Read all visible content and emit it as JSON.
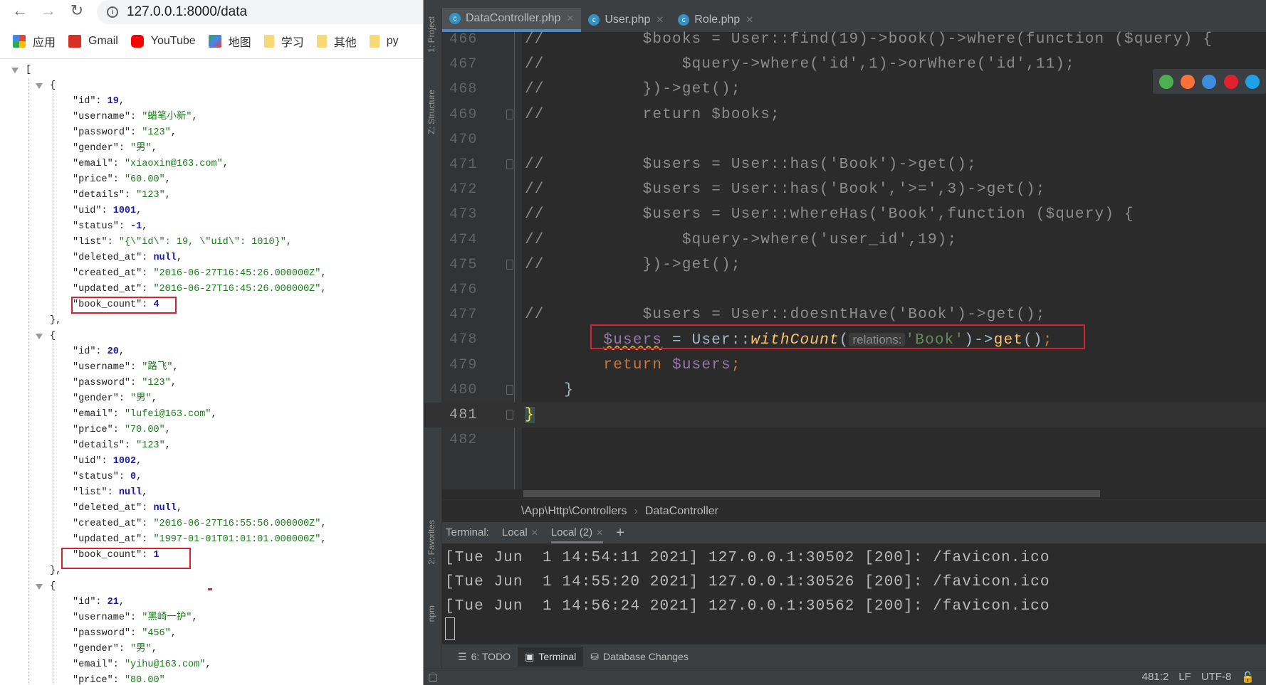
{
  "browser": {
    "url": "127.0.0.1:8000/data",
    "bookmarks": [
      {
        "label": "应用",
        "icon": "apps-grid-icon"
      },
      {
        "label": "Gmail",
        "icon": "gmail-icon"
      },
      {
        "label": "YouTube",
        "icon": "youtube-icon"
      },
      {
        "label": "地图",
        "icon": "maps-icon"
      },
      {
        "label": "学习",
        "icon": "folder-icon"
      },
      {
        "label": "其他",
        "icon": "folder-icon"
      },
      {
        "label": "py",
        "icon": "folder-icon"
      }
    ],
    "json_open": "[",
    "records": [
      {
        "fields": [
          {
            "key": "id",
            "value": "19",
            "type": "n"
          },
          {
            "key": "username",
            "value": "蜡笔小新",
            "type": "s"
          },
          {
            "key": "password",
            "value": "123",
            "type": "s"
          },
          {
            "key": "gender",
            "value": "男",
            "type": "s"
          },
          {
            "key": "email",
            "value": "xiaoxin@163.com",
            "type": "s"
          },
          {
            "key": "price",
            "value": "60.00",
            "type": "s"
          },
          {
            "key": "details",
            "value": "123",
            "type": "s"
          },
          {
            "key": "uid",
            "value": "1001",
            "type": "n"
          },
          {
            "key": "status",
            "value": "-1",
            "type": "n"
          },
          {
            "key": "list",
            "value": "{\\\"id\\\": 19, \\\"uid\\\": 1010}",
            "type": "s"
          },
          {
            "key": "deleted_at",
            "value": "null",
            "type": "n"
          },
          {
            "key": "created_at",
            "value": "2016-06-27T16:45:26.000000Z",
            "type": "s"
          },
          {
            "key": "updated_at",
            "value": "2016-06-27T16:45:26.000000Z",
            "type": "s"
          },
          {
            "key": "book_count",
            "value": "4",
            "type": "n",
            "highlight": true
          }
        ]
      },
      {
        "fields": [
          {
            "key": "id",
            "value": "20",
            "type": "n"
          },
          {
            "key": "username",
            "value": "路飞",
            "type": "s"
          },
          {
            "key": "password",
            "value": "123",
            "type": "s"
          },
          {
            "key": "gender",
            "value": "男",
            "type": "s"
          },
          {
            "key": "email",
            "value": "lufei@163.com",
            "type": "s"
          },
          {
            "key": "price",
            "value": "70.00",
            "type": "s"
          },
          {
            "key": "details",
            "value": "123",
            "type": "s"
          },
          {
            "key": "uid",
            "value": "1002",
            "type": "n"
          },
          {
            "key": "status",
            "value": "0",
            "type": "n"
          },
          {
            "key": "list",
            "value": "null",
            "type": "n"
          },
          {
            "key": "deleted_at",
            "value": "null",
            "type": "n"
          },
          {
            "key": "created_at",
            "value": "2016-06-27T16:55:56.000000Z",
            "type": "s"
          },
          {
            "key": "updated_at",
            "value": "1997-01-01T01:01:01.000000Z",
            "type": "s"
          },
          {
            "key": "book_count",
            "value": "1",
            "type": "n",
            "highlight": true
          }
        ]
      },
      {
        "fields": [
          {
            "key": "id",
            "value": "21",
            "type": "n"
          },
          {
            "key": "username",
            "value": "黑崎一护",
            "type": "s"
          },
          {
            "key": "password",
            "value": "456",
            "type": "s"
          },
          {
            "key": "gender",
            "value": "男",
            "type": "s"
          },
          {
            "key": "email",
            "value": "yihu@163.com",
            "type": "s"
          },
          {
            "key": "price",
            "value": "80.00",
            "type": "s"
          }
        ]
      }
    ]
  },
  "ide": {
    "side_labels": [
      "1: Project",
      "Z: Structure",
      "2: Favorites",
      "npm"
    ],
    "tabs": [
      {
        "label": "DataController.php",
        "active": true
      },
      {
        "label": "User.php",
        "active": false
      },
      {
        "label": "Role.php",
        "active": false
      }
    ],
    "code_lines": [
      {
        "num": "466",
        "tokens": [
          [
            "t-cm",
            "//          $books = User::find(19)->book()->where(function ($query) {"
          ]
        ]
      },
      {
        "num": "467",
        "tokens": [
          [
            "t-cm",
            "//              $query->where('id',1)->orWhere('id',11);"
          ]
        ]
      },
      {
        "num": "468",
        "tokens": [
          [
            "t-cm",
            "//          })->get();"
          ]
        ]
      },
      {
        "num": "469",
        "fold": true,
        "tokens": [
          [
            "t-cm",
            "//          return $books;"
          ]
        ]
      },
      {
        "num": "470",
        "tokens": []
      },
      {
        "num": "471",
        "fold": true,
        "tokens": [
          [
            "t-cm",
            "//          $users = User::has('Book')->get();"
          ]
        ]
      },
      {
        "num": "472",
        "tokens": [
          [
            "t-cm",
            "//          $users = User::has('Book','>=',3)->get();"
          ]
        ]
      },
      {
        "num": "473",
        "tokens": [
          [
            "t-cm",
            "//          $users = User::whereHas('Book',function ($query) {"
          ]
        ]
      },
      {
        "num": "474",
        "tokens": [
          [
            "t-cm",
            "//              $query->where('user_id',19);"
          ]
        ]
      },
      {
        "num": "475",
        "fold": true,
        "tokens": [
          [
            "t-cm",
            "//          })->get();"
          ]
        ]
      },
      {
        "num": "476",
        "tokens": []
      },
      {
        "num": "477",
        "tokens": [
          [
            "t-cm",
            "//          $users = User::doesntHave('Book')->get();"
          ]
        ]
      },
      {
        "num": "478",
        "tokens": [
          [
            "t-plain",
            "        "
          ],
          [
            "t-var squig",
            "$users"
          ],
          [
            "t-plain",
            " = User::"
          ],
          [
            "t-fn",
            "withCount"
          ],
          [
            "t-plain",
            "("
          ],
          [
            "t-hint",
            "relations:"
          ],
          [
            "t-str",
            "'Book'"
          ],
          [
            "t-plain",
            ")->"
          ],
          [
            "t-call",
            "get"
          ],
          [
            "t-plain",
            "()"
          ],
          [
            "t-kw",
            ";"
          ]
        ]
      },
      {
        "num": "479",
        "tokens": [
          [
            "t-kw",
            "        return "
          ],
          [
            "t-var",
            "$users"
          ],
          [
            "t-kw",
            ";"
          ]
        ]
      },
      {
        "num": "480",
        "fold": true,
        "tokens": [
          [
            "t-plain",
            "    }"
          ]
        ]
      },
      {
        "num": "481",
        "fold": true,
        "current": true,
        "tokens": [
          [
            "t-brace",
            "}"
          ]
        ]
      },
      {
        "num": "482",
        "tokens": []
      }
    ],
    "breadcrumb": [
      "\\App\\Http\\Controllers",
      "DataController"
    ],
    "terminal": {
      "label": "Terminal:",
      "tabs": [
        {
          "label": "Local",
          "active": false
        },
        {
          "label": "Local (2)",
          "active": true
        }
      ],
      "add": "+",
      "lines": [
        "[Tue Jun  1 14:54:11 2021] 127.0.0.1:30502 [200]: /favicon.ico",
        "[Tue Jun  1 14:55:20 2021] 127.0.0.1:30526 [200]: /favicon.ico",
        "[Tue Jun  1 14:56:24 2021] 127.0.0.1:30562 [200]: /favicon.ico"
      ]
    },
    "tool_windows": [
      {
        "label": "6: TODO",
        "icon": "list-icon",
        "active": false
      },
      {
        "label": "Terminal",
        "icon": "terminal-icon",
        "active": true
      },
      {
        "label": "Database Changes",
        "icon": "database-icon",
        "active": false
      }
    ],
    "status": {
      "position": "481:2",
      "line_sep": "LF",
      "encoding": "UTF-8"
    },
    "browser_icons": [
      {
        "name": "chrome-icon",
        "color": "#4caf50"
      },
      {
        "name": "firefox-icon",
        "color": "#ff7139"
      },
      {
        "name": "safari-icon",
        "color": "#3b8de0"
      },
      {
        "name": "opera-icon",
        "color": "#e0212f"
      },
      {
        "name": "ie-icon",
        "color": "#1ea1e8"
      }
    ]
  }
}
